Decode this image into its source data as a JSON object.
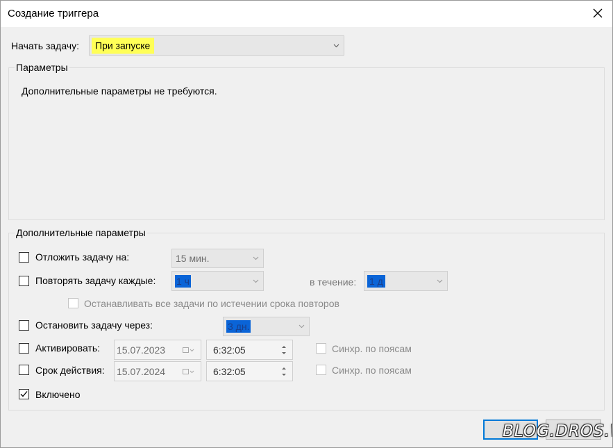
{
  "window": {
    "title": "Создание триггера"
  },
  "begin_task": {
    "label": "Начать задачу:",
    "selected": "При запуске",
    "highlight_color": "#ffff57"
  },
  "params": {
    "group_title": "Параметры",
    "message": "Дополнительные параметры не требуются."
  },
  "advanced": {
    "group_title": "Дополнительные параметры",
    "delay": {
      "label": "Отложить задачу на:",
      "value": "15 мин.",
      "checked": false
    },
    "repeat": {
      "label": "Повторять задачу каждые:",
      "value": "1 ч",
      "duration_label": "в течение:",
      "duration_value": "1 д",
      "checked": false
    },
    "stop_all": {
      "label": "Останавливать все задачи по истечении срока повторов",
      "checked": false
    },
    "stop_after": {
      "label": "Остановить задачу через:",
      "value": "3 дн.",
      "checked": false
    },
    "activate": {
      "label": "Активировать:",
      "date": "15.07.2023",
      "time": "6:32:05",
      "sync_label": "Синхр. по поясам",
      "checked": false
    },
    "expire": {
      "label": "Срок действия:",
      "date": "15.07.2024",
      "time": "6:32:05",
      "sync_label": "Синхр. по поясам",
      "checked": false
    },
    "enabled": {
      "label": "Включено",
      "checked": true
    }
  },
  "watermark": "BLOG.DROS.WS",
  "colors": {
    "accent": "#0078d7",
    "selection": "#0a64d7"
  }
}
